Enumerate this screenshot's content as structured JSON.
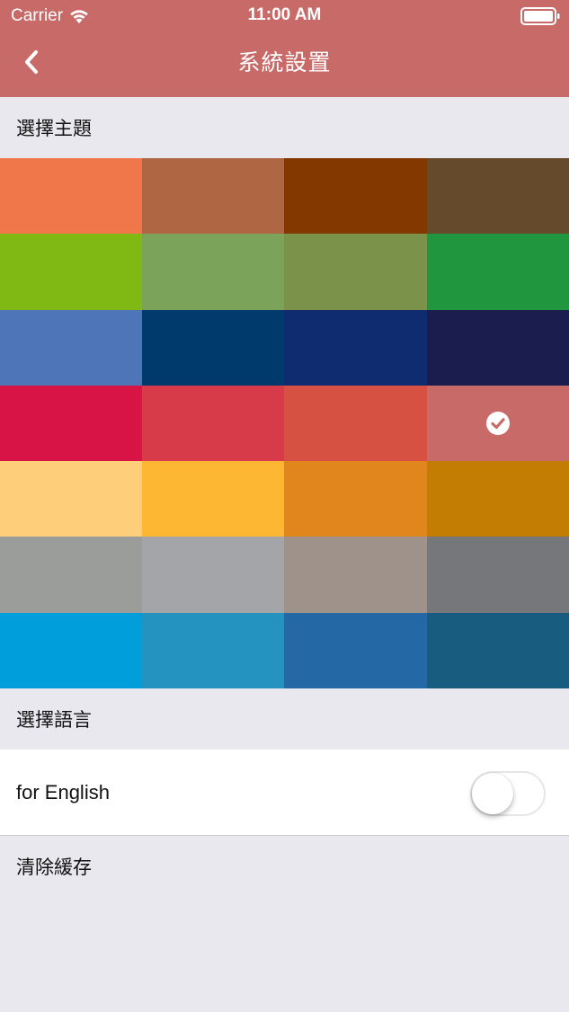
{
  "status_bar": {
    "carrier": "Carrier",
    "time": "11:00 AM"
  },
  "nav": {
    "title": "系統設置",
    "back_icon": "chevron-left-icon"
  },
  "theme_section": {
    "header": "選擇主題",
    "colors": [
      "#f07749",
      "#af6743",
      "#833800",
      "#654a2c",
      "#81b914",
      "#7ba359",
      "#7a924a",
      "#20963f",
      "#4f75b9",
      "#003a6c",
      "#102c71",
      "#1b1d4f",
      "#d81446",
      "#d73a49",
      "#d75143",
      "#c86a68",
      "#ffce7a",
      "#fdb732",
      "#e1861c",
      "#c27d02",
      "#9b9d9b",
      "#a4a5a8",
      "#9f928a",
      "#75777b",
      "#009fdb",
      "#2593c0",
      "#2468a5",
      "#185c80"
    ],
    "selected_index": 15
  },
  "language_section": {
    "header": "選擇語言",
    "english_label": "for English",
    "english_enabled": false
  },
  "cache_section": {
    "label": "清除緩存"
  }
}
